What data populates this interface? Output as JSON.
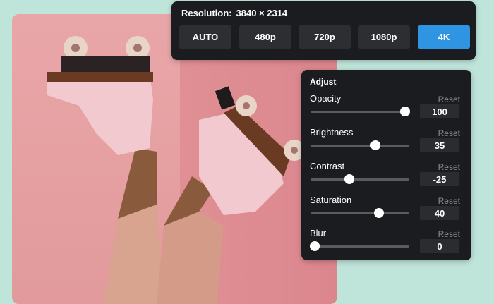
{
  "resolution": {
    "label": "Resolution:",
    "value": "3840 × 2314",
    "options": [
      "AUTO",
      "480p",
      "720p",
      "1080p",
      "4K"
    ],
    "selected": "4K",
    "accent_color": "#2f95e3"
  },
  "adjust": {
    "title": "Adjust",
    "reset_label": "Reset",
    "sliders": [
      {
        "label": "Opacity",
        "value": "100",
        "level": 0.96
      },
      {
        "label": "Brightness",
        "value": "35",
        "level": 0.66
      },
      {
        "label": "Contrast",
        "value": "-25",
        "level": 0.39
      },
      {
        "label": "Saturation",
        "value": "40",
        "level": 0.69
      },
      {
        "label": "Blur",
        "value": "0",
        "level": 0.04
      }
    ]
  },
  "image": {
    "subject": "roller-skates-photo"
  }
}
